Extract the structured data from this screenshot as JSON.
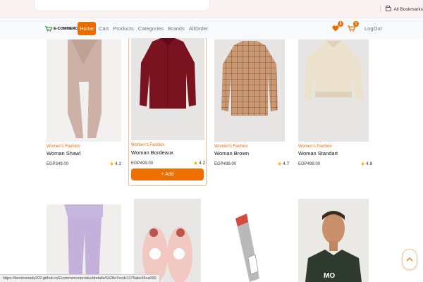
{
  "browser": {
    "bookmarks_label": "All Bookmarks"
  },
  "navbar": {
    "brand": "E-COMMERCE",
    "links": [
      "Home",
      "Cart",
      "Products",
      "Categories",
      "Brands",
      "AllOrder"
    ],
    "wishlist_count": "2",
    "cart_count": "1",
    "logout": "LogOut"
  },
  "products": [
    {
      "category": "Women's Fashion",
      "title": "Woman Shawl",
      "price": "EGP349.00",
      "rating": "4.2"
    },
    {
      "category": "Women's Fashion",
      "title": "Woman Bordeaux",
      "price": "EGP499.00",
      "rating": "4.2",
      "button": "+ Add"
    },
    {
      "category": "Women's Fashion",
      "title": "Woman Brown",
      "price": "EGP499.00",
      "rating": "4.7"
    },
    {
      "category": "Women's Fashion",
      "title": "Woman Standart",
      "price": "EGP499.00",
      "rating": "4.8"
    }
  ],
  "status_bar": {
    "url": "https://kerolosnady202.github.io/Ecommerce/productdetails/6428e7ecdc1175abc65ca090"
  },
  "colors": {
    "accent": "#ed6c00",
    "star": "#f5b301"
  }
}
